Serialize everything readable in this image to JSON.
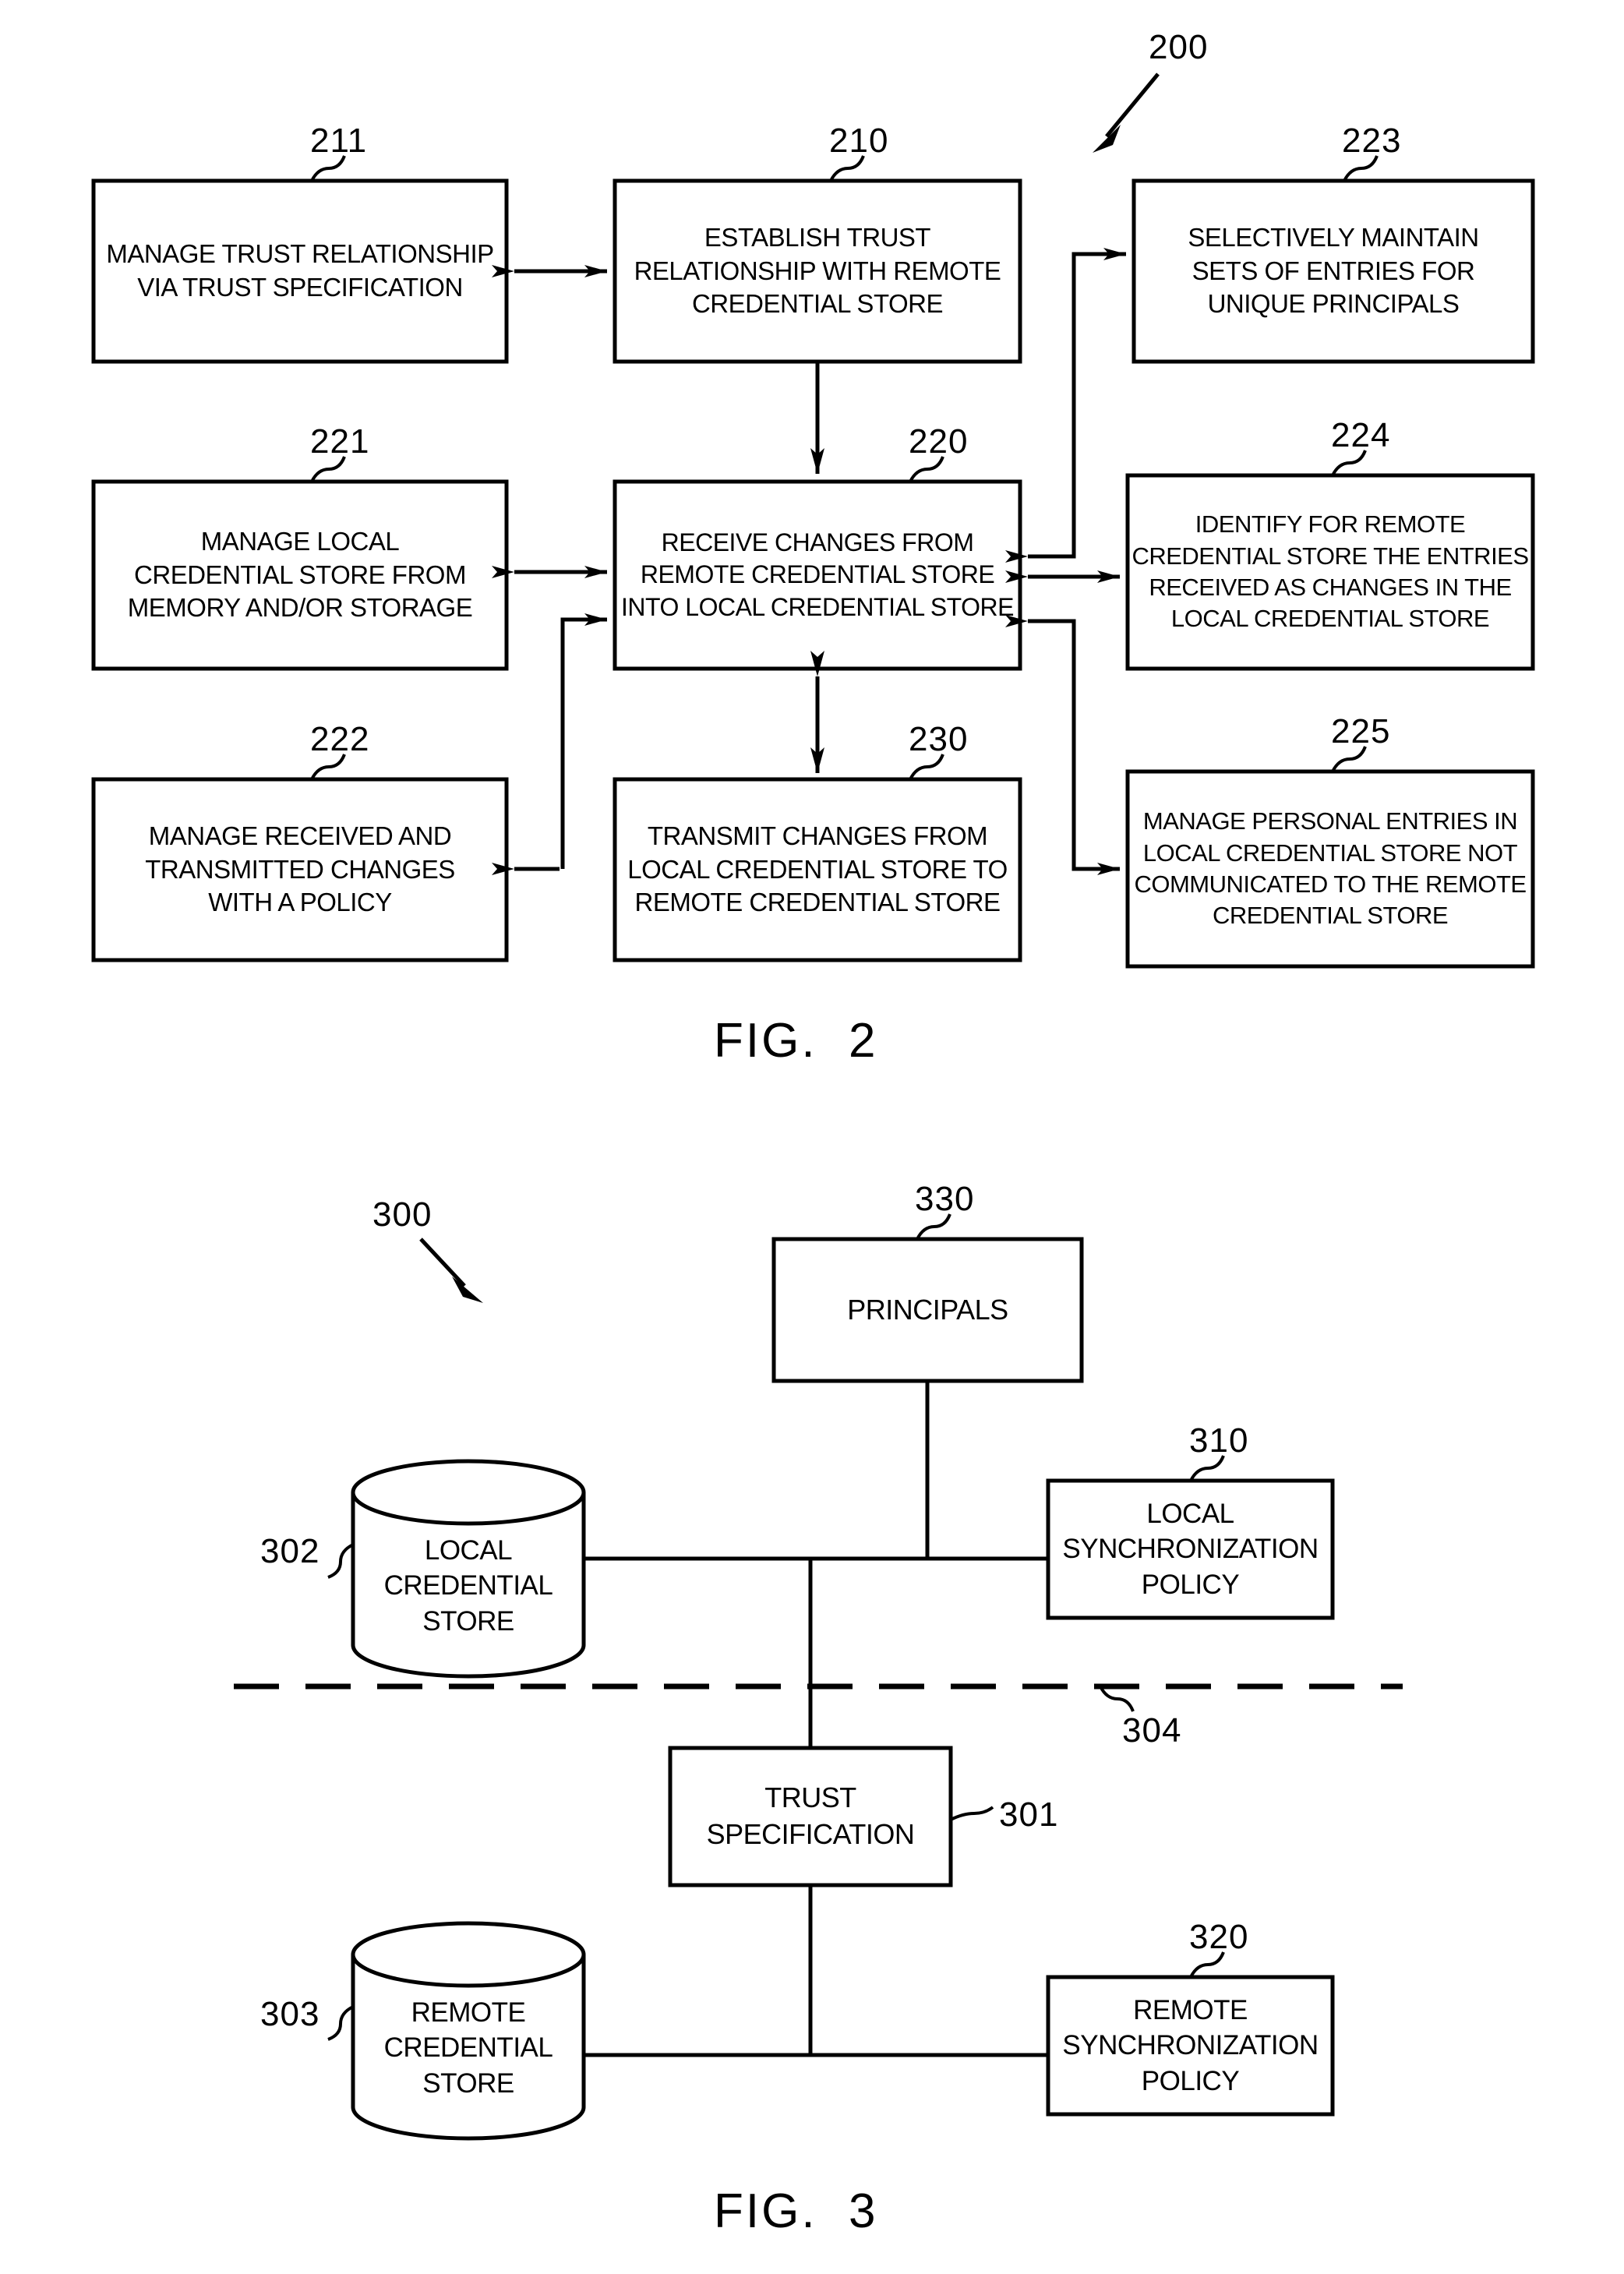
{
  "document": {
    "type": "patent-drawing-sheet",
    "figures": [
      {
        "id": "fig2",
        "caption": "FIG.  2",
        "ref": "200",
        "boxes": [
          {
            "ref": "211",
            "lines": [
              "MANAGE TRUST RELATIONSHIP",
              "VIA TRUST SPECIFICATION"
            ]
          },
          {
            "ref": "210",
            "lines": [
              "ESTABLISH TRUST",
              "RELATIONSHIP WITH REMOTE",
              "CREDENTIAL STORE"
            ]
          },
          {
            "ref": "223",
            "lines": [
              "SELECTIVELY MAINTAIN",
              "SETS OF ENTRIES FOR",
              "UNIQUE PRINCIPALS"
            ]
          },
          {
            "ref": "221",
            "lines": [
              "MANAGE LOCAL",
              "CREDENTIAL STORE FROM",
              "MEMORY AND/OR STORAGE"
            ]
          },
          {
            "ref": "220",
            "lines": [
              "RECEIVE CHANGES FROM",
              "REMOTE CREDENTIAL STORE",
              "INTO LOCAL CREDENTIAL STORE"
            ]
          },
          {
            "ref": "224",
            "lines": [
              "IDENTIFY FOR REMOTE",
              "CREDENTIAL STORE THE ENTRIES",
              "RECEIVED AS CHANGES IN THE",
              "LOCAL CREDENTIAL STORE"
            ]
          },
          {
            "ref": "222",
            "lines": [
              "MANAGE RECEIVED AND",
              "TRANSMITTED CHANGES",
              "WITH A POLICY"
            ]
          },
          {
            "ref": "230",
            "lines": [
              "TRANSMIT CHANGES FROM",
              "LOCAL CREDENTIAL STORE TO",
              "REMOTE CREDENTIAL STORE"
            ]
          },
          {
            "ref": "225",
            "lines": [
              "MANAGE PERSONAL ENTRIES IN",
              "LOCAL CREDENTIAL STORE NOT",
              "COMMUNICATED TO THE REMOTE",
              "CREDENTIAL STORE"
            ]
          }
        ]
      },
      {
        "id": "fig3",
        "caption": "FIG.  3",
        "ref": "300",
        "boxes": [
          {
            "ref": "330",
            "lines": [
              "PRINCIPALS"
            ]
          },
          {
            "ref": "310",
            "lines": [
              "LOCAL",
              "SYNCHRONIZATION",
              "POLICY"
            ]
          },
          {
            "ref": "301",
            "lines": [
              "TRUST",
              "SPECIFICATION"
            ]
          },
          {
            "ref": "320",
            "lines": [
              "REMOTE",
              "SYNCHRONIZATION",
              "POLICY"
            ]
          }
        ],
        "cylinders": [
          {
            "ref": "302",
            "lines": [
              "LOCAL",
              "CREDENTIAL",
              "STORE"
            ]
          },
          {
            "ref": "303",
            "lines": [
              "REMOTE",
              "CREDENTIAL",
              "STORE"
            ]
          }
        ],
        "divider": {
          "ref": "304",
          "style": "dash-dot"
        }
      }
    ]
  },
  "colors": {
    "ink": "#000000",
    "paper": "#ffffff"
  },
  "fig2": {
    "caption": "FIG.  2",
    "ref200": "200",
    "b211": {
      "ref": "211",
      "l1": "MANAGE TRUST RELATIONSHIP",
      "l2": "VIA TRUST SPECIFICATION"
    },
    "b210": {
      "ref": "210",
      "l1": "ESTABLISH TRUST",
      "l2": "RELATIONSHIP WITH REMOTE",
      "l3": "CREDENTIAL STORE"
    },
    "b223": {
      "ref": "223",
      "l1": "SELECTIVELY MAINTAIN",
      "l2": "SETS OF ENTRIES FOR",
      "l3": "UNIQUE PRINCIPALS"
    },
    "b221": {
      "ref": "221",
      "l1": "MANAGE LOCAL",
      "l2": "CREDENTIAL STORE FROM",
      "l3": "MEMORY AND/OR STORAGE"
    },
    "b220": {
      "ref": "220",
      "l1": "RECEIVE CHANGES FROM",
      "l2": "REMOTE CREDENTIAL STORE",
      "l3": "INTO LOCAL CREDENTIAL STORE"
    },
    "b224": {
      "ref": "224",
      "l1": "IDENTIFY FOR REMOTE",
      "l2": "CREDENTIAL STORE THE ENTRIES",
      "l3": "RECEIVED AS CHANGES IN THE",
      "l4": "LOCAL CREDENTIAL STORE"
    },
    "b222": {
      "ref": "222",
      "l1": "MANAGE RECEIVED AND",
      "l2": "TRANSMITTED CHANGES",
      "l3": "WITH A POLICY"
    },
    "b230": {
      "ref": "230",
      "l1": "TRANSMIT CHANGES FROM",
      "l2": "LOCAL CREDENTIAL STORE TO",
      "l3": "REMOTE CREDENTIAL STORE"
    },
    "b225": {
      "ref": "225",
      "l1": "MANAGE PERSONAL ENTRIES IN",
      "l2": "LOCAL CREDENTIAL STORE NOT",
      "l3": "COMMUNICATED TO THE REMOTE",
      "l4": "CREDENTIAL STORE"
    }
  },
  "fig3": {
    "caption": "FIG.  3",
    "ref300": "300",
    "b330": {
      "ref": "330",
      "l1": "PRINCIPALS"
    },
    "b310": {
      "ref": "310",
      "l1": "LOCAL",
      "l2": "SYNCHRONIZATION",
      "l3": "POLICY"
    },
    "b301": {
      "ref": "301",
      "l1": "TRUST",
      "l2": "SPECIFICATION"
    },
    "b320": {
      "ref": "320",
      "l1": "REMOTE",
      "l2": "SYNCHRONIZATION",
      "l3": "POLICY"
    },
    "c302": {
      "ref": "302",
      "l1": "LOCAL",
      "l2": "CREDENTIAL",
      "l3": "STORE"
    },
    "c303": {
      "ref": "303",
      "l1": "REMOTE",
      "l2": "CREDENTIAL",
      "l3": "STORE"
    },
    "ref304": "304"
  }
}
